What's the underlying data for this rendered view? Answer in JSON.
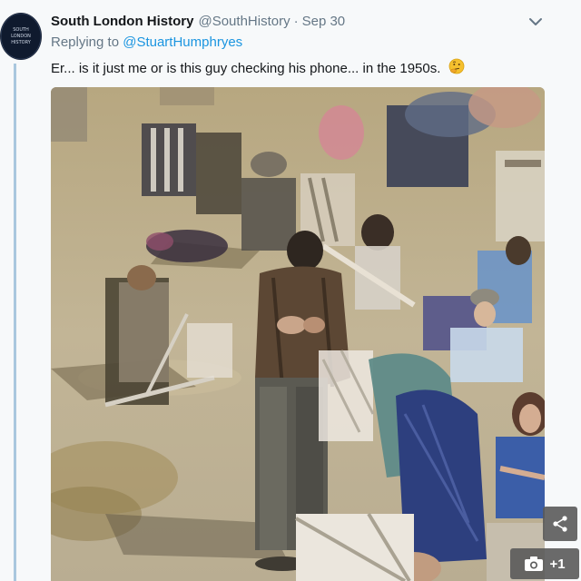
{
  "account": {
    "name": "South London History",
    "handle": "@SouthHistory",
    "separator": "·",
    "date": "Sep 30",
    "avatar_text": [
      "SOUTH",
      "LONDON",
      "HISTORY"
    ]
  },
  "reply": {
    "prefix": "Replying to",
    "to_handle": "@StuartHumphryes"
  },
  "tweet": {
    "text": "Er... is it just me or is this guy checking his phone... in the 1950s.",
    "emoji_icon": "thinking-face-icon"
  },
  "media": {
    "photo_count_label": "+1",
    "share_icon": "share-icon",
    "camera_icon": "camera-icon"
  },
  "colors": {
    "link": "#1b95e0",
    "secondary_text": "#657786",
    "thread_line": "#a9c7de"
  }
}
